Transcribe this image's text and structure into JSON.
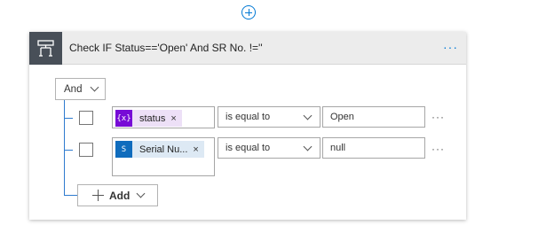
{
  "step_title": "Check IF Status=='Open' And SR No. !=''",
  "group": {
    "operator": "And"
  },
  "rows": [
    {
      "token": {
        "label": "status",
        "icon": "variable-icon",
        "icon_text": "{x}",
        "remove": "×"
      },
      "operator": "is equal to",
      "value": "Open",
      "more": "···"
    },
    {
      "token": {
        "label": "Serial Nu...",
        "icon": "sharepoint-icon",
        "icon_text": "S",
        "remove": "×"
      },
      "operator": "is equal to",
      "value": "null",
      "more": "···"
    }
  ],
  "add_button": {
    "label": "Add"
  },
  "header_more": "···",
  "colors": {
    "accent": "#0078d4",
    "header_icon_bg": "#484f58",
    "variable_token_icon": "#770bd6",
    "variable_token_bg": "#ede0f7",
    "sharepoint_token_icon": "#0f6cbd",
    "sharepoint_token_bg": "#dde9f4",
    "tree_line": "#2e7bcf"
  }
}
